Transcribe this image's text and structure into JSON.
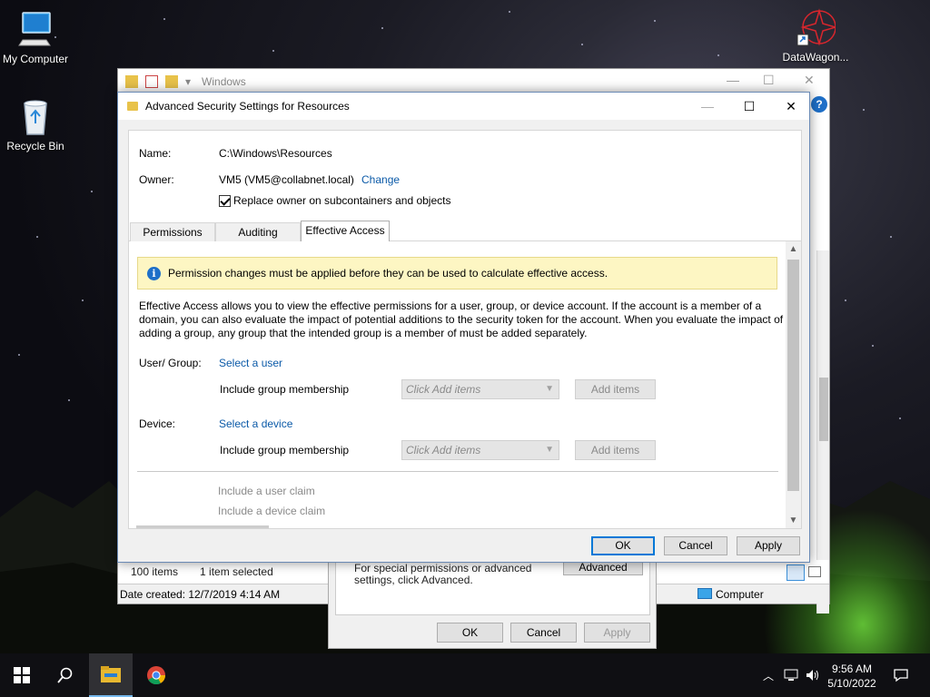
{
  "desktop": {
    "icons": [
      {
        "label": "My Computer",
        "icon": "computer-icon"
      },
      {
        "label": "Recycle Bin",
        "icon": "recycle-bin-icon"
      },
      {
        "label": "DataWagon...",
        "icon": "datawagon-shortcut-icon"
      }
    ]
  },
  "explorer": {
    "title": "Windows",
    "status_items": "100 items",
    "status_selected": "1 item selected",
    "date_created": "Date created: 12/7/2019 4:14 AM",
    "location": "Computer"
  },
  "properties": {
    "note": "For special permissions or advanced settings, click Advanced.",
    "advanced": "Advanced",
    "ok": "OK",
    "cancel": "Cancel",
    "apply": "Apply"
  },
  "dialog": {
    "title": "Advanced Security Settings for Resources",
    "name_label": "Name:",
    "name_value": "C:\\Windows\\Resources",
    "owner_label": "Owner:",
    "owner_value": "VM5 (VM5@collabnet.local)",
    "change_link": "Change",
    "replace_owner": "Replace owner on subcontainers and objects",
    "tabs": [
      "Permissions",
      "Auditing",
      "Effective Access"
    ],
    "active_tab": "Effective Access",
    "info_banner": "Permission changes must be applied before they can be used to calculate effective access.",
    "description": "Effective Access allows you to view the effective permissions for a user, group, or device account. If the account is a member of a domain, you can also evaluate the impact of potential additions to the security token for the account. When you evaluate the impact of adding a group, any group that the intended group is a member of must be added separately.",
    "user_group_label": "User/ Group:",
    "select_user": "Select a user",
    "include_membership": "Include group membership",
    "click_add_items": "Click Add items",
    "add_items": "Add items",
    "device_label": "Device:",
    "select_device": "Select a device",
    "include_user_claim": "Include a user claim",
    "include_device_claim": "Include a device claim",
    "ok": "OK",
    "cancel": "Cancel",
    "apply": "Apply"
  },
  "taskbar": {
    "time": "9:56 AM",
    "date": "5/10/2022"
  },
  "colors": {
    "link": "#0b5aa8",
    "info_bg": "#fdf6c3",
    "accent": "#0078d7"
  }
}
